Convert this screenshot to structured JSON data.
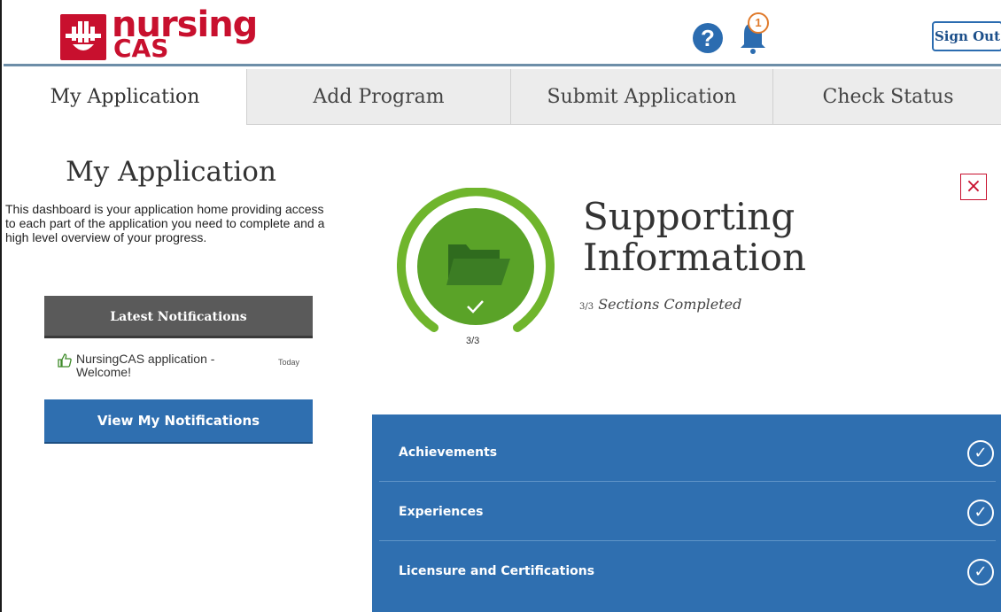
{
  "header": {
    "logo_line1": "nursing",
    "logo_line2": "CAS",
    "help_symbol": "?",
    "notification_count": "1",
    "signout_label": "Sign Out"
  },
  "tabs": [
    {
      "label": "My Application",
      "active": true
    },
    {
      "label": "Add Program",
      "active": false
    },
    {
      "label": "Submit Application",
      "active": false
    },
    {
      "label": "Check Status",
      "active": false
    }
  ],
  "sidebar": {
    "title": "My Application",
    "description": "This dashboard is your application home providing access to each part of the application you need to complete and a high level overview of your progress.",
    "notifications_header": "Latest Notifications",
    "notification": {
      "text": "NursingCAS application - Welcome!",
      "date": "Today"
    },
    "view_button": "View My Notifications"
  },
  "main": {
    "progress_label": "3/3",
    "progress_fraction": 1.0,
    "section_title_line1": "Supporting",
    "section_title_line2": "Information",
    "section_fraction": "3/3",
    "section_subtitle": "Sections Completed",
    "close_symbol": "×",
    "items": [
      {
        "label": "Achievements",
        "completed": true
      },
      {
        "label": "Experiences",
        "completed": true
      },
      {
        "label": "Licensure and Certifications",
        "completed": true
      }
    ]
  },
  "colors": {
    "brand_red": "#c8102e",
    "accent_blue": "#2f6fb0",
    "progress_green": "#6fb52c"
  },
  "icons": [
    "question-icon",
    "bell-icon",
    "thumbs-up-icon",
    "folder-icon",
    "checkmark-icon",
    "close-icon",
    "check-circle-icon"
  ]
}
